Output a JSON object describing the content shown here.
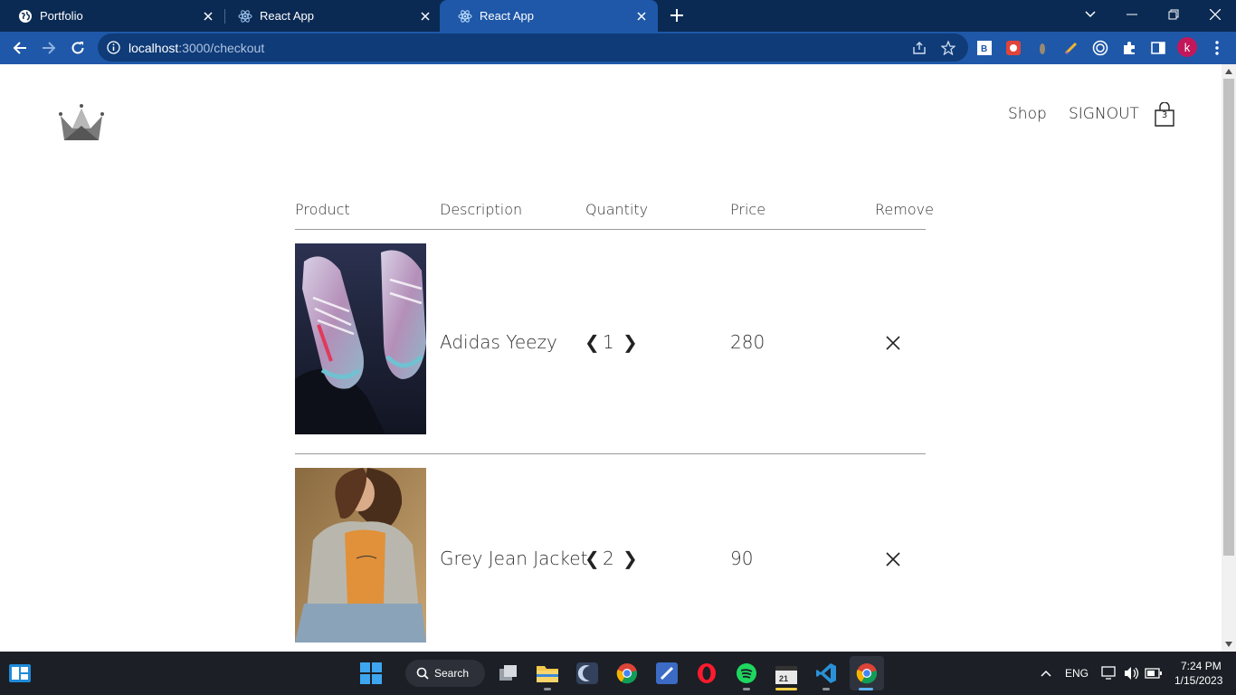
{
  "browser": {
    "tabs": [
      {
        "title": "Portfolio",
        "icon": "globe-icon",
        "active": false
      },
      {
        "title": "React App",
        "icon": "react-icon",
        "active": false
      },
      {
        "title": "React App",
        "icon": "react-icon",
        "active": true
      }
    ],
    "url_host": "localhost",
    "url_path": ":3000/checkout",
    "profile_initial": "k"
  },
  "header": {
    "logo_icon": "crown-icon",
    "nav": [
      "Shop",
      "SIGNOUT"
    ],
    "cart_count": "3"
  },
  "checkout": {
    "columns": [
      "Product",
      "Description",
      "Quantity",
      "Price",
      "Remove"
    ],
    "items": [
      {
        "name": "Adidas Yeezy",
        "quantity": "1",
        "price": "280",
        "image": "sneakers-photo"
      },
      {
        "name": "Grey Jean Jacket",
        "quantity": "2",
        "price": "90",
        "image": "jacket-photo"
      }
    ],
    "decrease_symbol": "❮",
    "increase_symbol": "❯"
  },
  "taskbar": {
    "search_label": "Search",
    "language": "ENG",
    "time": "7:24 PM",
    "date": "1/15/2023"
  },
  "colors": {
    "tab_strip": "#0b2a53",
    "toolbar": "#1f58a8",
    "taskbar": "#1c1f26"
  }
}
